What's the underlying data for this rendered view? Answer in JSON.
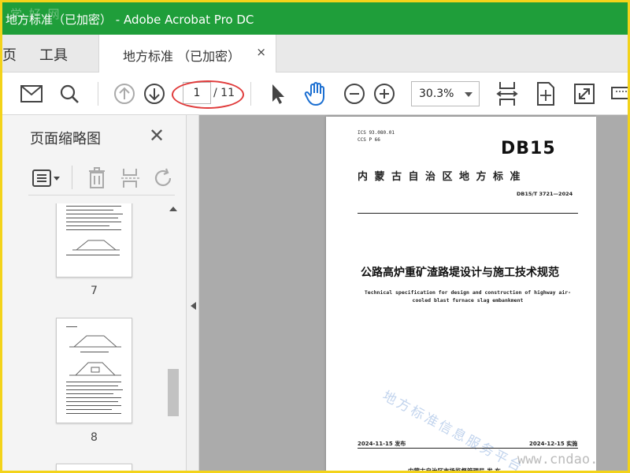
{
  "window": {
    "title": "地方标准（已加密） - Adobe Acrobat Pro DC",
    "watermark": "学 好 网"
  },
  "tabs": {
    "home_fragment": "页",
    "tools": "工具",
    "document_tab": "地方标准 （已加密）",
    "close_glyph": "×"
  },
  "toolbar": {
    "current_page": "1",
    "total_pages": "/ 11",
    "zoom": "30.3%"
  },
  "thumbnails_panel": {
    "title": "页面缩略图",
    "close_glyph": "✕",
    "pages": [
      {
        "number": "7"
      },
      {
        "number": "8"
      }
    ]
  },
  "document": {
    "ics": "ICS  93.080.01",
    "ccs": "CCS  P  66",
    "code": "DB15",
    "org": "内蒙古自治区地方标准",
    "std_no": "DB15/T 3721—2024",
    "cn_title": "公路高炉重矿渣路堤设计与施工技术规范",
    "en_title_line1": "Technical specification for design and construction of highway air-",
    "en_title_line2": "cooled blast furnace slag embankment",
    "watermark": "地方标准信息服务平台",
    "release_date": "2024-11-15 发布",
    "impl_date": "2024-12-15 实施",
    "issuer": "内蒙古自治区市场监督管理局      发  布"
  },
  "corner_watermark": "www.cndao."
}
